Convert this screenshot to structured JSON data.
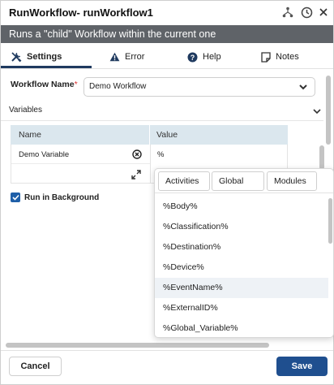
{
  "window": {
    "title": "RunWorkflow-  runWorkflow1",
    "subtitle": "Runs a \"child\" Workflow within the current one"
  },
  "tabs": [
    {
      "label": "Settings",
      "icon": "wrench-screwdriver-icon",
      "active": true
    },
    {
      "label": "Error",
      "icon": "warning-icon",
      "active": false
    },
    {
      "label": "Help",
      "icon": "help-icon",
      "active": false
    },
    {
      "label": "Notes",
      "icon": "notes-icon",
      "active": false
    }
  ],
  "form": {
    "workflow_name_label": "Workflow Name",
    "required_marker": "*",
    "workflow_name_value": "Demo Workflow",
    "variables_label": "Variables"
  },
  "variables_table": {
    "columns": [
      "Name",
      "Value"
    ],
    "rows": [
      {
        "name": "Demo Variable",
        "value": "%"
      }
    ]
  },
  "run_in_background": {
    "label": "Run in Background",
    "checked": true
  },
  "popup": {
    "tabs": [
      "Activities",
      "Global",
      "Modules"
    ],
    "items": [
      "%Body%",
      "%Classification%",
      "%Destination%",
      "%Device%",
      "%EventName%",
      "%ExternalID%",
      "%Global_Variable%"
    ],
    "highlighted_index": 4
  },
  "footer": {
    "cancel_label": "Cancel",
    "save_label": "Save"
  },
  "colors": {
    "subtitle_bg": "#5f6368",
    "accent": "#1f4f8f",
    "table_header_bg": "#dbe7ee",
    "required": "#dd3333"
  }
}
